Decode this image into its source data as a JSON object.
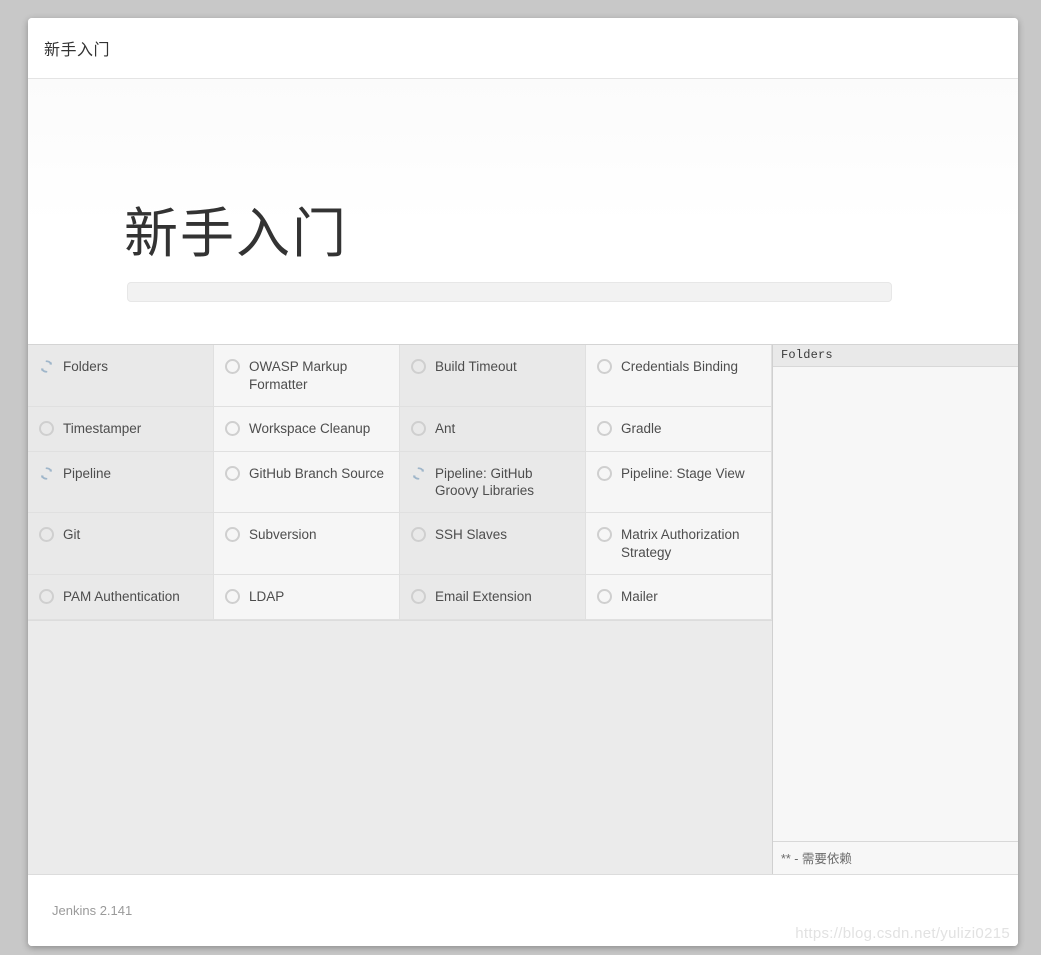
{
  "page": {
    "background_color": "#c8c8c8",
    "card_background": "#ffffff"
  },
  "header": {
    "title": "新手入门"
  },
  "hero": {
    "title": "新手入门",
    "progress_percent": 0,
    "progress_fill_color": "#4b8fd0",
    "progress_track_color": "#f2f2f2"
  },
  "plugins": [
    {
      "name": "Folders",
      "status": "installing"
    },
    {
      "name": "OWASP Markup Formatter",
      "status": "pending"
    },
    {
      "name": "Build Timeout",
      "status": "pending"
    },
    {
      "name": "Credentials Binding",
      "status": "pending"
    },
    {
      "name": "Timestamper",
      "status": "pending"
    },
    {
      "name": "Workspace Cleanup",
      "status": "pending"
    },
    {
      "name": "Ant",
      "status": "pending"
    },
    {
      "name": "Gradle",
      "status": "pending"
    },
    {
      "name": "Pipeline",
      "status": "installing"
    },
    {
      "name": "GitHub Branch Source",
      "status": "pending"
    },
    {
      "name": "Pipeline: GitHub Groovy Libraries",
      "status": "installing"
    },
    {
      "name": "Pipeline: Stage View",
      "status": "pending"
    },
    {
      "name": "Git",
      "status": "pending"
    },
    {
      "name": "Subversion",
      "status": "pending"
    },
    {
      "name": "SSH Slaves",
      "status": "pending"
    },
    {
      "name": "Matrix Authorization Strategy",
      "status": "pending"
    },
    {
      "name": "PAM Authentication",
      "status": "pending"
    },
    {
      "name": "LDAP",
      "status": "pending"
    },
    {
      "name": "Email Extension",
      "status": "pending"
    },
    {
      "name": "Mailer",
      "status": "pending"
    }
  ],
  "console": {
    "header_text": "Folders",
    "log_lines": [],
    "footer_note": "** - 需要依赖"
  },
  "footer": {
    "version": "Jenkins 2.141",
    "watermark": "https://blog.csdn.net/yulizi0215"
  },
  "icons": {
    "installing": "refresh-spinner-icon",
    "pending": "empty-circle-icon"
  }
}
